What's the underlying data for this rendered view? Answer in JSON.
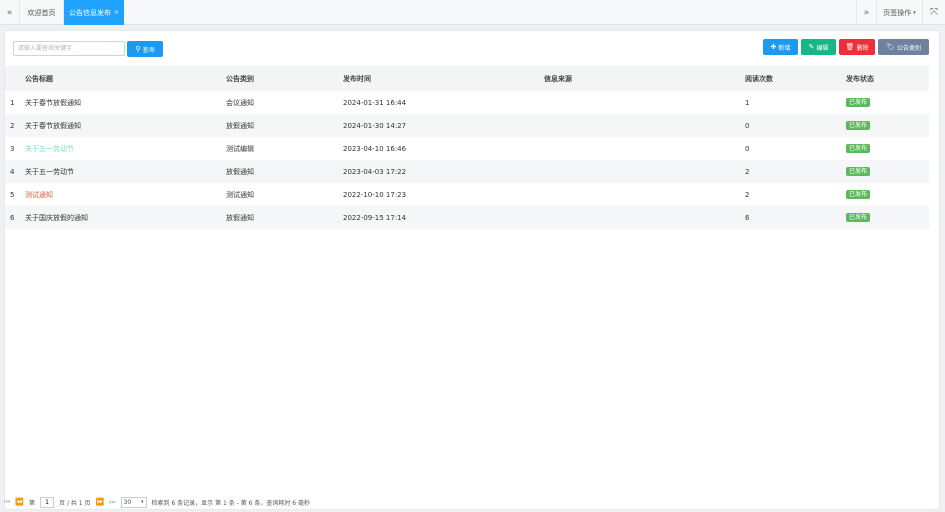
{
  "tabs": {
    "home": "欢迎首页",
    "active": "公告信息发布",
    "ops": "页签操作"
  },
  "toolbar": {
    "search_placeholder": "请输入要查询关键字",
    "search_label": "查询",
    "add_label": "新增",
    "edit_label": "编辑",
    "delete_label": "删除",
    "category_label": "公告类别"
  },
  "table": {
    "headers": {
      "title": "公告标题",
      "category": "公告类别",
      "time": "发布时间",
      "source": "信息来源",
      "reads": "阅读次数",
      "status": "发布状态"
    },
    "rows": [
      {
        "idx": "1",
        "title": "关于春节放假通知",
        "category": "会议通知",
        "time": "2024-01-31 16:44",
        "source": "",
        "reads": "1",
        "status": "已发布"
      },
      {
        "idx": "2",
        "title": "关于春节放假通知",
        "category": "放假通知",
        "time": "2024-01-30 14:27",
        "source": "",
        "reads": "0",
        "status": "已发布"
      },
      {
        "idx": "3",
        "title": "关于五一劳动节",
        "category": "测试编辑",
        "time": "2023-04-10 16:46",
        "source": "",
        "reads": "0",
        "status": "已发布"
      },
      {
        "idx": "4",
        "title": "关于五一劳动节",
        "category": "放假通知",
        "time": "2023-04-03 17:22",
        "source": "",
        "reads": "2",
        "status": "已发布"
      },
      {
        "idx": "5",
        "title": "测试通知",
        "category": "测试通知",
        "time": "2022-10-10 17:23",
        "source": "",
        "reads": "2",
        "status": "已发布"
      },
      {
        "idx": "6",
        "title": "关于国庆放假的通知",
        "category": "放假通知",
        "time": "2022-09-15 17:14",
        "source": "",
        "reads": "6",
        "status": "已发布"
      }
    ]
  },
  "pager": {
    "page_prefix": "第",
    "page_value": "1",
    "page_suffix": "页 / 共 1 页",
    "page_size": "30",
    "summary": "检索到 6 条记录，显示 第 1 条 - 第 6 条，查询耗时 6 毫秒"
  },
  "colors": {
    "primary": "#1b9bf0",
    "success": "#17b785",
    "danger": "#ee2f3a",
    "neutral": "#6e82a0",
    "status_badge": "#5cb85c"
  }
}
